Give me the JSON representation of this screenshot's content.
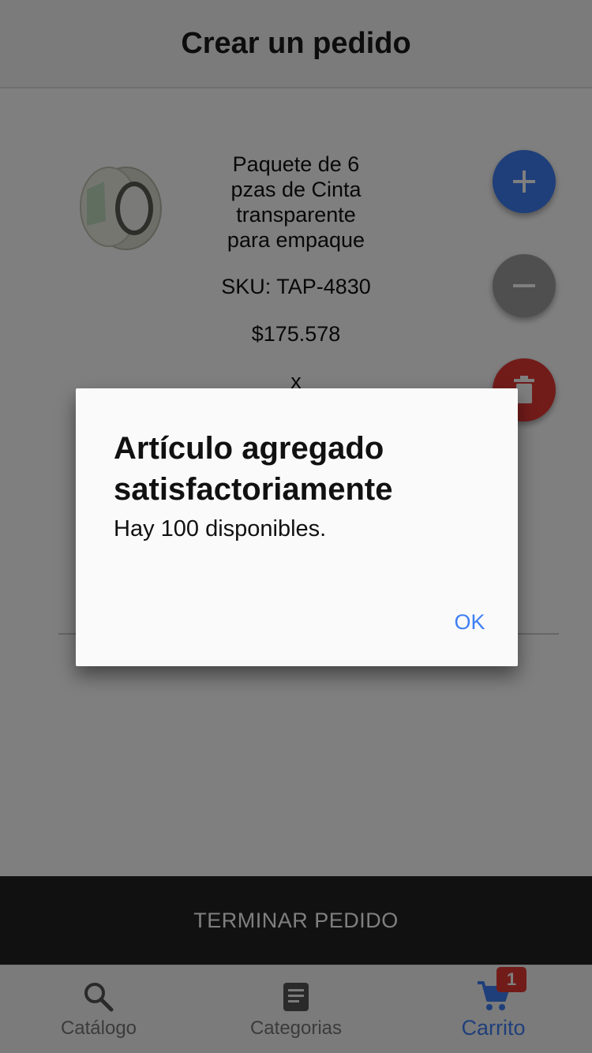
{
  "header": {
    "title": "Crear un pedido"
  },
  "product": {
    "name": "Paquete de 6 pzas de Cinta transparente para empaque",
    "sku": "SKU: TAP-4830",
    "price": "$175.578",
    "quantity_prefix": "x",
    "image_icon": "tape-roll-icon"
  },
  "actions": {
    "add_icon": "plus-icon",
    "remove_icon": "minus-icon",
    "delete_icon": "trash-icon"
  },
  "finish": {
    "label": "TERMINAR PEDIDO"
  },
  "bottom_nav": {
    "items": [
      {
        "label": "Catálogo",
        "icon": "search-icon",
        "active": false
      },
      {
        "label": "Categorias",
        "icon": "list-icon",
        "active": false
      },
      {
        "label": "Carrito",
        "icon": "cart-icon",
        "active": true,
        "badge": "1"
      }
    ]
  },
  "dialog": {
    "title": "Artículo agregado satisfactoriamente",
    "message": "Hay 100 disponibles.",
    "ok_label": "OK"
  },
  "colors": {
    "accent": "#3f7ff5",
    "danger": "#e53935",
    "neutral_fab": "#9e9e9e",
    "finish_bar": "#222222"
  }
}
